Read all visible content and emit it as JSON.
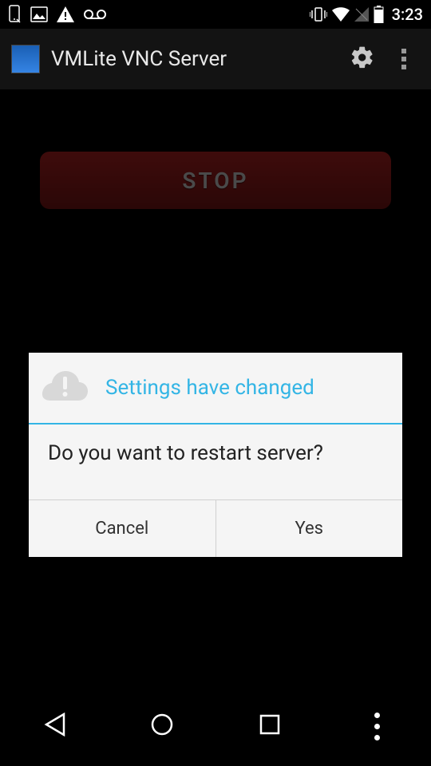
{
  "status_bar": {
    "time": "3:23"
  },
  "app_bar": {
    "title": "VMLite VNC Server"
  },
  "main": {
    "stop_button_label": "STOP"
  },
  "dialog": {
    "title": "Settings have changed",
    "message": "Do you want to restart server?",
    "cancel_label": "Cancel",
    "yes_label": "Yes"
  }
}
